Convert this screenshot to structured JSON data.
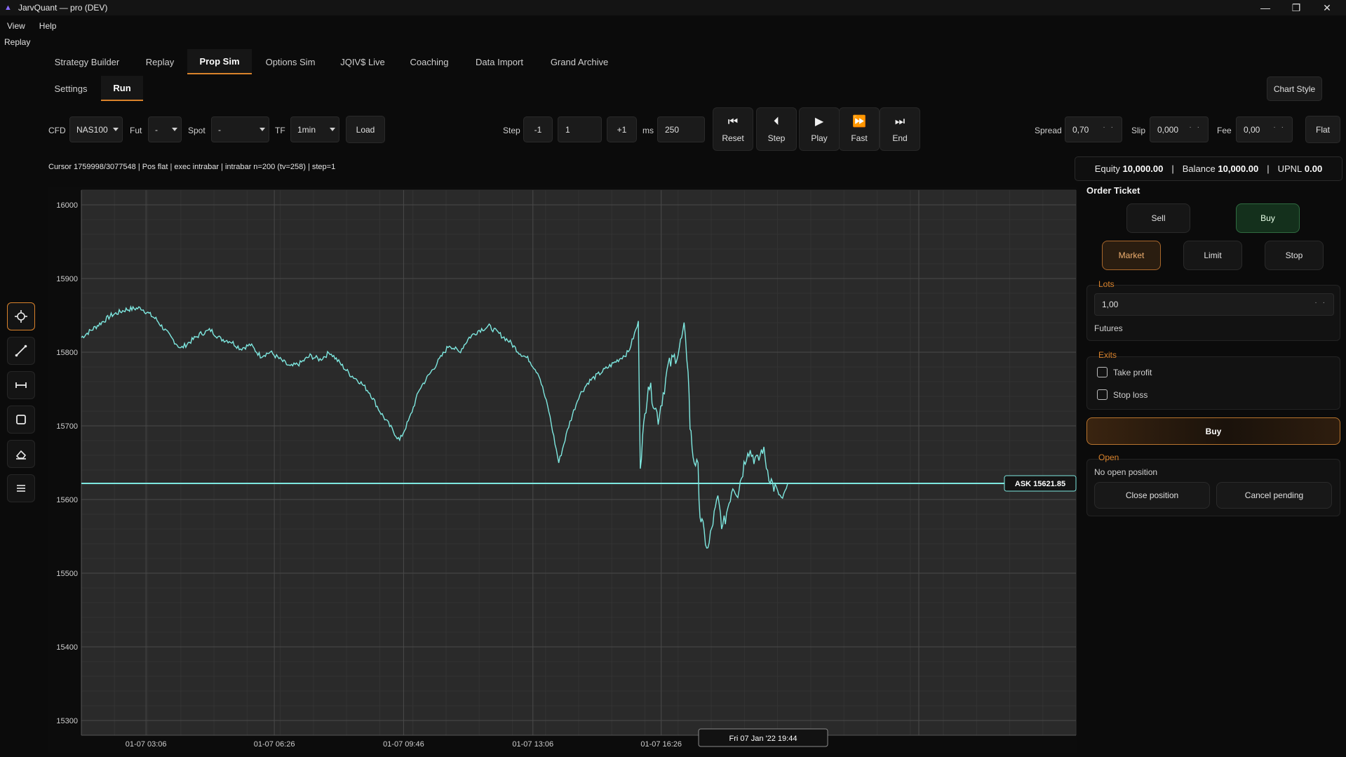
{
  "window": {
    "title": "JarvQuant — pro (DEV)",
    "minimize": "—",
    "restore": "❐",
    "close": "✕"
  },
  "menu": {
    "items": [
      "View",
      "Help"
    ]
  },
  "replay_label": "Replay",
  "tabs": [
    "Strategy Builder",
    "Replay",
    "Prop Sim",
    "Options Sim",
    "JQIV$ Live",
    "Coaching",
    "Data Import",
    "Grand Archive"
  ],
  "active_tab": "Prop Sim",
  "subtabs": [
    "Settings",
    "Run"
  ],
  "active_subtab": "Run",
  "chart_style_label": "Chart Style",
  "toolbar": {
    "cfd_label": "CFD",
    "cfd_value": "NAS100",
    "fut_label": "Fut",
    "fut_value": "-",
    "spot_label": "Spot",
    "spot_value": "-",
    "tf_label": "TF",
    "tf_value": "1min",
    "load_label": "Load",
    "step_label": "Step",
    "step_minus": "-1",
    "step_value": "1",
    "step_plus": "+1",
    "ms_label": "ms",
    "ms_value": "250",
    "reset": "Reset",
    "step": "Step",
    "play": "Play",
    "fast": "Fast",
    "end": "End",
    "spread_label": "Spread",
    "spread_value": "0,70",
    "slip_label": "Slip",
    "slip_value": "0,000",
    "fee_label": "Fee",
    "fee_value": "0,00",
    "flat_label": "Flat"
  },
  "status_line": "Cursor 1759998/3077548 | Pos flat | exec intrabar | intrabar n=200 (tv=258) | step=1",
  "account": {
    "equity_label": "Equity",
    "equity": "10,000.00",
    "balance_label": "Balance",
    "balance": "10,000.00",
    "upnl_label": "UPNL",
    "upnl": "0.00"
  },
  "left_tools": [
    "crosshair-icon",
    "trendline-icon",
    "horizontal-measure-icon",
    "rectangle-icon",
    "eraser-icon",
    "menu-icon"
  ],
  "order_ticket": {
    "title": "Order Ticket",
    "sell": "Sell",
    "buy": "Buy",
    "market": "Market",
    "limit": "Limit",
    "stop": "Stop",
    "lots_title": "Lots",
    "lots_value": "1,00",
    "lots_kind": "Futures",
    "exits_title": "Exits",
    "take_profit": "Take profit",
    "stop_loss": "Stop loss",
    "submit": "Buy",
    "open_title": "Open",
    "open_status": "No open position",
    "close_position": "Close position",
    "cancel_pending": "Cancel pending"
  },
  "colors": {
    "accent": "#d9822b",
    "series": "#7ee8e0",
    "buy_green": "#1f4a2c",
    "background": "#0b0b0b"
  },
  "chart_data": {
    "type": "line",
    "symbol": "NAS100",
    "ylim": [
      15280,
      16020
    ],
    "y_ticks": [
      16000,
      15900,
      15800,
      15700,
      15600,
      15500,
      15400,
      15300
    ],
    "x_tick_labels": [
      "01-07 03:06",
      "01-07 06:26",
      "01-07 09:46",
      "01-07 13:06",
      "01-07 16:26"
    ],
    "x_range_label": "Fri 07 Jan '22 19:44",
    "ask_label": "ASK 15621.85",
    "ask_price": 15621.85,
    "x_max": 1000,
    "series": [
      {
        "x": [
          0,
          15,
          30,
          45,
          60,
          75,
          90,
          100,
          110,
          120,
          130,
          140,
          150,
          160,
          170,
          180,
          190,
          200,
          210,
          220,
          230,
          240,
          250,
          260,
          270,
          280,
          290,
          300,
          310,
          320,
          330,
          340,
          350,
          360,
          370,
          380,
          390,
          400,
          410,
          420,
          430,
          440,
          450,
          460,
          470,
          480,
          490,
          500,
          510,
          520,
          530,
          540,
          550,
          560,
          562,
          570,
          580,
          590,
          600,
          606,
          610,
          612,
          615,
          620,
          622,
          625,
          630,
          635,
          640,
          645,
          650,
          655,
          660,
          665,
          670,
          675,
          680,
          685,
          690,
          695,
          700,
          705,
          710
        ],
        "y": [
          15820,
          15835,
          15850,
          15858,
          15860,
          15845,
          15820,
          15805,
          15815,
          15825,
          15830,
          15818,
          15815,
          15805,
          15810,
          15795,
          15800,
          15790,
          15780,
          15785,
          15795,
          15790,
          15800,
          15785,
          15770,
          15760,
          15745,
          15720,
          15700,
          15680,
          15710,
          15750,
          15770,
          15790,
          15810,
          15800,
          15820,
          15830,
          15835,
          15825,
          15815,
          15800,
          15790,
          15770,
          15720,
          15650,
          15700,
          15740,
          15760,
          15770,
          15780,
          15790,
          15800,
          15840,
          15650,
          15760,
          15710,
          15780,
          15800,
          15830,
          15780,
          15700,
          15660,
          15640,
          15580,
          15560,
          15530,
          15570,
          15600,
          15560,
          15590,
          15620,
          15610,
          15640,
          15670,
          15660,
          15650,
          15670,
          15640,
          15620,
          15610,
          15600,
          15621
        ]
      }
    ]
  }
}
